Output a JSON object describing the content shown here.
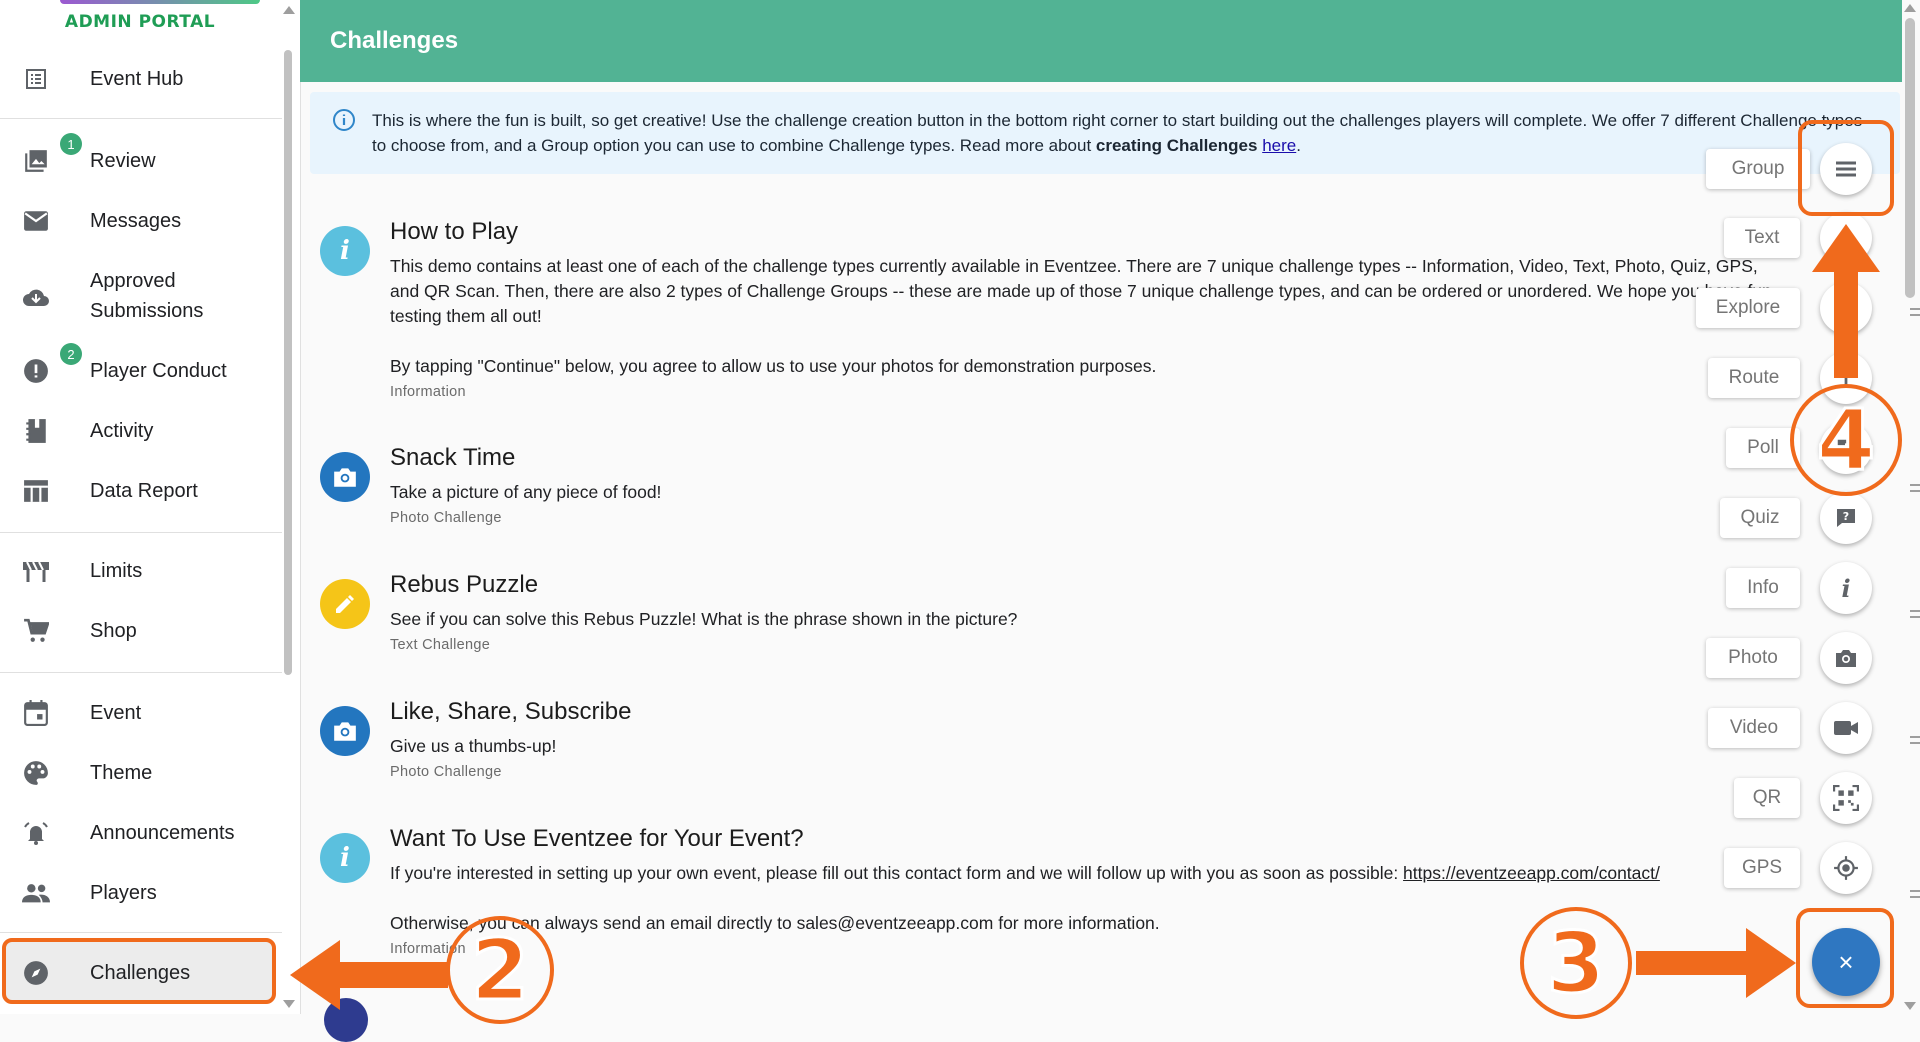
{
  "app": {
    "portal_label": "ADMIN PORTAL"
  },
  "sidebar": {
    "items": [
      {
        "label": "Event Hub",
        "icon": "list-icon"
      },
      {
        "label": "Review",
        "icon": "photo-review-icon",
        "badge": "1"
      },
      {
        "label": "Messages",
        "icon": "mail-icon"
      },
      {
        "label": "Approved\nSubmissions",
        "icon": "cloud-download-icon"
      },
      {
        "label": "Player Conduct",
        "icon": "alert-icon",
        "badge": "2"
      },
      {
        "label": "Activity",
        "icon": "notebook-icon"
      },
      {
        "label": "Data Report",
        "icon": "table-icon"
      },
      {
        "label": "Limits",
        "icon": "barrier-icon"
      },
      {
        "label": "Shop",
        "icon": "cart-icon"
      },
      {
        "label": "Event",
        "icon": "calendar-icon"
      },
      {
        "label": "Theme",
        "icon": "palette-icon"
      },
      {
        "label": "Announcements",
        "icon": "bell-icon"
      },
      {
        "label": "Players",
        "icon": "people-icon"
      },
      {
        "label": "Challenges",
        "icon": "compass-icon",
        "active": true
      }
    ]
  },
  "header": {
    "title": "Challenges"
  },
  "info": {
    "text_before": "This is where the fun is built, so get creative! Use the challenge creation button in the bottom right corner to start building out the challenges players will complete. We offer 7 different Challenge types to choose from, and a Group option you can use to combine Challenge types. Read more about ",
    "bold": "creating Challenges",
    "space": " ",
    "link": "here",
    "text_after": "."
  },
  "challenges": [
    {
      "title": "How to Play",
      "desc": "This demo contains at least one of each of the challenge types currently available in Eventzee. There are 7 unique challenge types -- Information, Video, Text, Photo, Quiz, GPS, and QR Scan. Then, there are also 2 types of Challenge Groups -- these are made up of those 7 unique challenge types, and can be ordered or unordered. We hope you have fun testing them all out!",
      "desc2": "By tapping \"Continue\" below, you agree to allow us to use your photos for demonstration purposes.",
      "type": "Information",
      "icon": "info-icon"
    },
    {
      "title": "Snack Time",
      "desc": "Take a picture of any piece of food!",
      "type": "Photo Challenge",
      "icon": "camera-icon"
    },
    {
      "title": "Rebus Puzzle",
      "desc": "See if you can solve this Rebus Puzzle! What is the phrase shown in the picture?",
      "type": "Text Challenge",
      "icon": "pencil-icon"
    },
    {
      "title": "Like, Share, Subscribe",
      "desc": "Give us a thumbs-up!",
      "type": "Photo Challenge",
      "icon": "camera-icon"
    },
    {
      "title": "Want To Use Eventzee for Your Event?",
      "desc": "If you're interested in setting up your own event, please fill out this contact form and we will follow up with you as soon as possible: ",
      "link": "https://eventzeeapp.com/contact/",
      "desc2": "Otherwise, you can always send an email directly to sales@eventzeeapp.com for more information.",
      "type": "Information",
      "icon": "info-icon"
    }
  ],
  "speed_dial": [
    {
      "label": "Group",
      "icon": "menu-lines-icon"
    },
    {
      "label": "Text",
      "icon": "pencil-icon"
    },
    {
      "label": "Explore",
      "icon": "explore-icon"
    },
    {
      "label": "Route",
      "icon": "route-icon"
    },
    {
      "label": "Poll",
      "icon": "poll-icon"
    },
    {
      "label": "Quiz",
      "icon": "quiz-icon"
    },
    {
      "label": "Info",
      "icon": "info-icon"
    },
    {
      "label": "Photo",
      "icon": "camera-icon"
    },
    {
      "label": "Video",
      "icon": "video-icon"
    },
    {
      "label": "QR",
      "icon": "qr-icon"
    },
    {
      "label": "GPS",
      "icon": "gps-icon"
    }
  ],
  "fab": {
    "symbol": "×"
  },
  "annotations": {
    "step2": "2",
    "step3": "3",
    "step4": "4",
    "accent": "#f06a1c"
  }
}
